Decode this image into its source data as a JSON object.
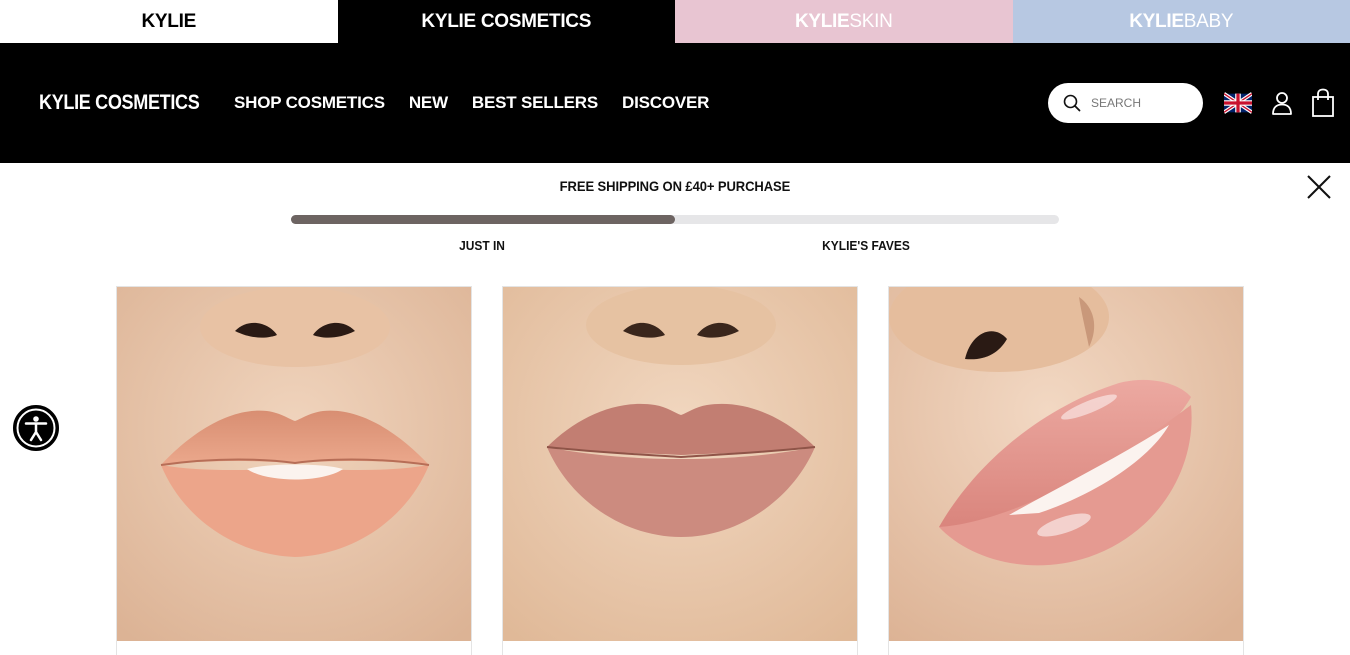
{
  "brand_strip": {
    "tabs": [
      {
        "main": "KYLIE",
        "sub": ""
      },
      {
        "main": "KYLIE COSMETICS",
        "sub": ""
      },
      {
        "main": "KYLIE",
        "sub": "SKIN"
      },
      {
        "main": "KYLIE",
        "sub": "BABY"
      }
    ],
    "colors": {
      "kylie": "#ffffff",
      "cosmetics": "#000000",
      "skin": "#e8c5d2",
      "baby": "#b7c8e2"
    }
  },
  "header": {
    "logo": "KYLIE COSMETICS",
    "nav": [
      "SHOP COSMETICS",
      "NEW",
      "BEST SELLERS",
      "DISCOVER"
    ],
    "search": {
      "placeholder": "SEARCH",
      "value": ""
    },
    "icons": [
      "search-icon",
      "uk-flag-icon",
      "account-icon",
      "shopping-bag-icon"
    ]
  },
  "promo": {
    "text": "FREE SHIPPING ON £40+ PURCHASE",
    "close_icon": "close-icon"
  },
  "tabs": {
    "items": [
      "JUST IN",
      "KYLIE'S FAVES"
    ],
    "active_index": 0,
    "progress_fraction": 0.5
  },
  "products": [
    {
      "image": "lips-matte-peach",
      "shade_color": "#e2967a"
    },
    {
      "image": "lips-matte-mauve",
      "shade_color": "#c9897f"
    },
    {
      "image": "lips-gloss-pink",
      "shade_color": "#e39890"
    }
  ],
  "accessibility": {
    "icon": "accessibility-icon"
  }
}
